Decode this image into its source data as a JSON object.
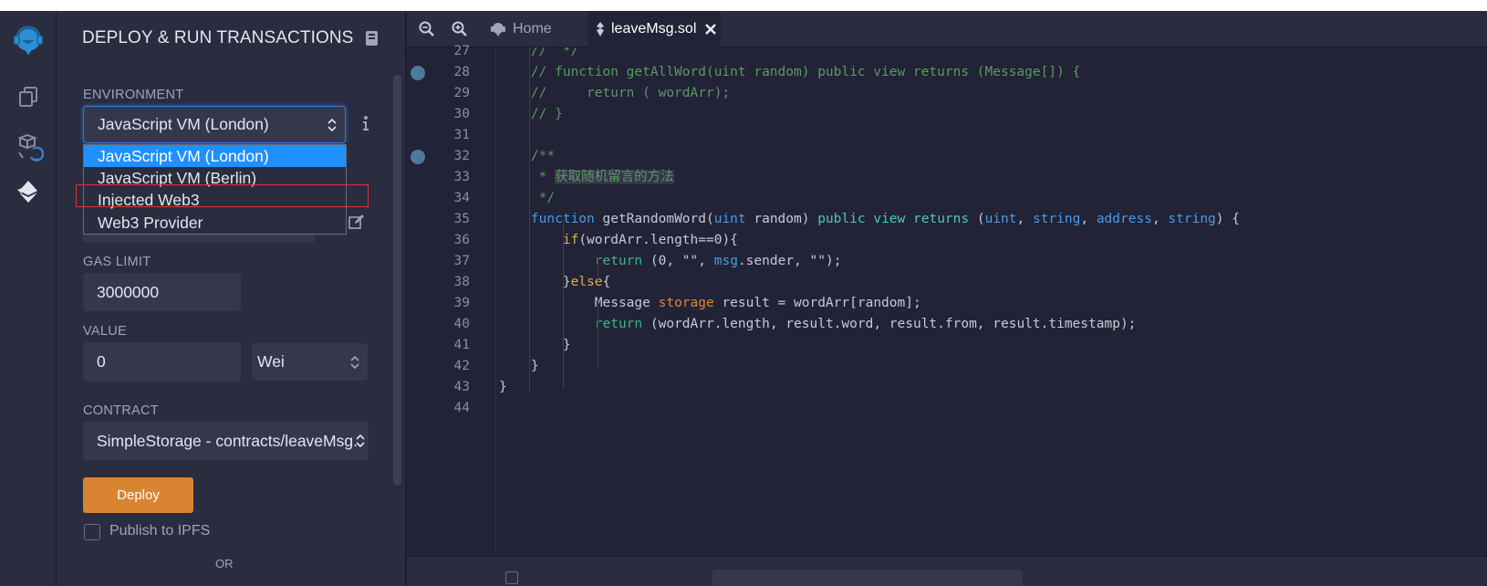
{
  "panel": {
    "title": "DEPLOY & RUN TRANSACTIONS",
    "environment_label": "ENVIRONMENT",
    "environment_value": "JavaScript VM (London)",
    "environment_options": [
      "JavaScript VM (London)",
      "JavaScript VM (Berlin)",
      "Injected Web3",
      "Web3 Provider"
    ],
    "gas_limit_label": "GAS LIMIT",
    "gas_limit_value": "3000000",
    "value_label": "VALUE",
    "value_amount": "0",
    "value_unit": "Wei",
    "contract_label": "CONTRACT",
    "contract_value": "SimpleStorage - contracts/leaveMsg.",
    "deploy_label": "Deploy",
    "publish_label": "Publish to IPFS",
    "partial_text": "OR"
  },
  "tabs": {
    "home_label": "Home",
    "file_label": "leaveMsg.sol"
  },
  "editor": {
    "line_numbers": [
      "27",
      "28",
      "29",
      "30",
      "31",
      "32",
      "33",
      "34",
      "35",
      "36",
      "37",
      "38",
      "39",
      "40",
      "41",
      "42",
      "43",
      "44"
    ],
    "lines": [
      "    //  */",
      "    // function getAllWord(uint random) public view returns (Message[]) {",
      "    //     return ( wordArr);",
      "    // }",
      "",
      "    /**",
      "     * 获取随机留言的方法",
      "     */",
      "    function getRandomWord(uint random) public view returns (uint, string, address, string) {",
      "        if(wordArr.length==0){",
      "            return (0, \"\", msg.sender, \"\");",
      "        }else{",
      "            Message storage result = wordArr[random];",
      "            return (wordArr.length, result.word, result.from, result.timestamp);",
      "        }",
      "    }",
      "}",
      ""
    ]
  },
  "colors": {
    "accent": "#1e90ff",
    "deploy": "#d98433",
    "highlight_box": "#e0343a"
  }
}
